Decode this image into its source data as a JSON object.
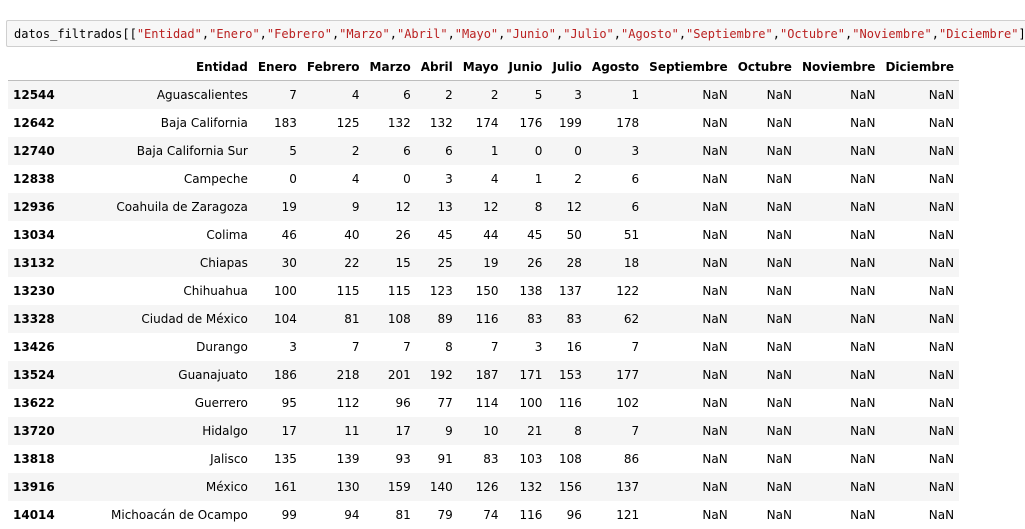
{
  "input_cell": {
    "code_prefix": "datos_filtrados[[",
    "code_items": [
      "\"Entidad\"",
      "\"Enero\"",
      "\"Febrero\"",
      "\"Marzo\"",
      "\"Abril\"",
      "\"Mayo\"",
      "\"Junio\"",
      "\"Julio\"",
      "\"Agosto\"",
      "\"Septiembre\"",
      "\"Octubre\"",
      "\"Noviembre\"",
      "\"Diciembre\""
    ],
    "code_separator": ",",
    "code_suffix": "]]"
  },
  "output_table": {
    "columns": [
      "",
      "Entidad",
      "Enero",
      "Febrero",
      "Marzo",
      "Abril",
      "Mayo",
      "Junio",
      "Julio",
      "Agosto",
      "Septiembre",
      "Octubre",
      "Noviembre",
      "Diciembre"
    ],
    "rows": [
      [
        "12544",
        "Aguascalientes",
        "7",
        "4",
        "6",
        "2",
        "2",
        "5",
        "3",
        "1",
        "NaN",
        "NaN",
        "NaN",
        "NaN"
      ],
      [
        "12642",
        "Baja California",
        "183",
        "125",
        "132",
        "132",
        "174",
        "176",
        "199",
        "178",
        "NaN",
        "NaN",
        "NaN",
        "NaN"
      ],
      [
        "12740",
        "Baja California Sur",
        "5",
        "2",
        "6",
        "6",
        "1",
        "0",
        "0",
        "3",
        "NaN",
        "NaN",
        "NaN",
        "NaN"
      ],
      [
        "12838",
        "Campeche",
        "0",
        "4",
        "0",
        "3",
        "4",
        "1",
        "2",
        "6",
        "NaN",
        "NaN",
        "NaN",
        "NaN"
      ],
      [
        "12936",
        "Coahuila de Zaragoza",
        "19",
        "9",
        "12",
        "13",
        "12",
        "8",
        "12",
        "6",
        "NaN",
        "NaN",
        "NaN",
        "NaN"
      ],
      [
        "13034",
        "Colima",
        "46",
        "40",
        "26",
        "45",
        "44",
        "45",
        "50",
        "51",
        "NaN",
        "NaN",
        "NaN",
        "NaN"
      ],
      [
        "13132",
        "Chiapas",
        "30",
        "22",
        "15",
        "25",
        "19",
        "26",
        "28",
        "18",
        "NaN",
        "NaN",
        "NaN",
        "NaN"
      ],
      [
        "13230",
        "Chihuahua",
        "100",
        "115",
        "115",
        "123",
        "150",
        "138",
        "137",
        "122",
        "NaN",
        "NaN",
        "NaN",
        "NaN"
      ],
      [
        "13328",
        "Ciudad de México",
        "104",
        "81",
        "108",
        "89",
        "116",
        "83",
        "83",
        "62",
        "NaN",
        "NaN",
        "NaN",
        "NaN"
      ],
      [
        "13426",
        "Durango",
        "3",
        "7",
        "7",
        "8",
        "7",
        "3",
        "16",
        "7",
        "NaN",
        "NaN",
        "NaN",
        "NaN"
      ],
      [
        "13524",
        "Guanajuato",
        "186",
        "218",
        "201",
        "192",
        "187",
        "171",
        "153",
        "177",
        "NaN",
        "NaN",
        "NaN",
        "NaN"
      ],
      [
        "13622",
        "Guerrero",
        "95",
        "112",
        "96",
        "77",
        "114",
        "100",
        "116",
        "102",
        "NaN",
        "NaN",
        "NaN",
        "NaN"
      ],
      [
        "13720",
        "Hidalgo",
        "17",
        "11",
        "17",
        "9",
        "10",
        "21",
        "8",
        "7",
        "NaN",
        "NaN",
        "NaN",
        "NaN"
      ],
      [
        "13818",
        "Jalisco",
        "135",
        "139",
        "93",
        "91",
        "83",
        "103",
        "108",
        "86",
        "NaN",
        "NaN",
        "NaN",
        "NaN"
      ],
      [
        "13916",
        "México",
        "161",
        "130",
        "159",
        "140",
        "126",
        "132",
        "156",
        "137",
        "NaN",
        "NaN",
        "NaN",
        "NaN"
      ],
      [
        "14014",
        "Michoacán de Ocampo",
        "99",
        "94",
        "81",
        "79",
        "74",
        "116",
        "96",
        "121",
        "NaN",
        "NaN",
        "NaN",
        "NaN"
      ]
    ]
  },
  "colors": {
    "string_literal": "#ba2121",
    "input_background": "#f7f7f7",
    "input_border": "#cfcfcf",
    "striped_row": "#f5f5f5",
    "header_rule": "#bdbdbd"
  }
}
